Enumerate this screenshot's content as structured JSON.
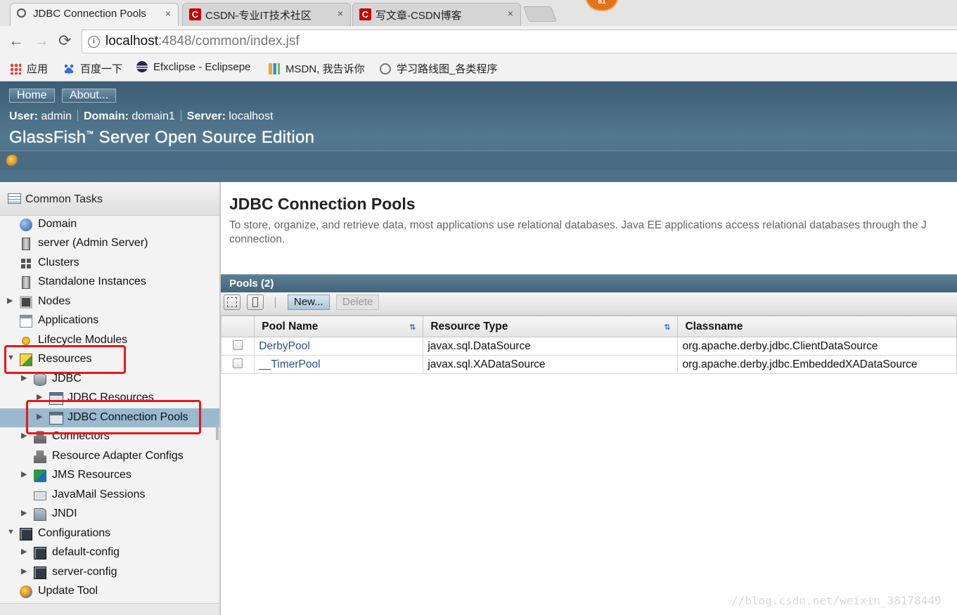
{
  "browser": {
    "tabs": [
      {
        "title": "JDBC Connection Pools",
        "close": "×",
        "active": true
      },
      {
        "title": "CSDN-专业IT技术社区",
        "close": "×",
        "active": false
      },
      {
        "title": "写文章-CSDN博客",
        "close": "×",
        "active": false
      }
    ],
    "badge": "81",
    "address": {
      "host": "localhost",
      "path": ":4848/common/index.jsf"
    },
    "nav": {
      "back": "←",
      "forward": "→",
      "reload": "⟳"
    },
    "bookmarks": [
      {
        "label": "应用",
        "icon": "apps-grid-icon"
      },
      {
        "label": "百度一下",
        "icon": "baidu-paw-icon"
      },
      {
        "label": "Efxclipse - Eclipsepe",
        "icon": "eclipse-icon"
      },
      {
        "label": "MSDN, 我告诉你",
        "icon": "msdn-icon"
      },
      {
        "label": "学习路线图_各类程序",
        "icon": "clock-icon"
      }
    ]
  },
  "header": {
    "home": "Home",
    "about": "About...",
    "user_label": "User:",
    "user": "admin",
    "domain_label": "Domain:",
    "domain": "domain1",
    "server_label": "Server:",
    "server": "localhost",
    "product": "GlassFish",
    "product_tm": "™",
    "product_rest": " Server Open Source Edition"
  },
  "tree": {
    "header": "Common Tasks",
    "items": {
      "domain": "Domain",
      "server": "server (Admin Server)",
      "clusters": "Clusters",
      "standalone": "Standalone Instances",
      "nodes": "Nodes",
      "applications": "Applications",
      "lifecycle": "Lifecycle Modules",
      "resources": "Resources",
      "jdbc": "JDBC",
      "jdbc_resources": "JDBC Resources",
      "jdbc_pools": "JDBC Connection Pools",
      "connectors": "Connectors",
      "resource_adapter": "Resource Adapter Configs",
      "jms": "JMS Resources",
      "javamail": "JavaMail Sessions",
      "jndi": "JNDI",
      "configurations": "Configurations",
      "default_config": "default-config",
      "server_config": "server-config",
      "update_tool": "Update Tool"
    }
  },
  "main": {
    "title": "JDBC Connection Pools",
    "description": "To store, organize, and retrieve data, most applications use relational databases. Java EE applications access relational databases through the JDBC API. Before an application can access a database, it must get a connection.",
    "description_visible_1": "To store, organize, and retrieve data, most applications use relational databases. Java EE applications access relational databases through the J",
    "description_visible_2": "connection.",
    "pools_header": "Pools (2)",
    "new_button": "New...",
    "delete_button": "Delete",
    "columns": {
      "name": "Pool Name",
      "type": "Resource Type",
      "classname": "Classname"
    },
    "rows": [
      {
        "name": "DerbyPool",
        "type": "javax.sql.DataSource",
        "classname": "org.apache.derby.jdbc.ClientDataSource"
      },
      {
        "name": "__TimerPool",
        "type": "javax.sql.XADataSource",
        "classname": "org.apache.derby.jdbc.EmbeddedXADataSource"
      }
    ]
  },
  "watermark": "//blog.csdn.net/weixin_38178449",
  "colors": {
    "highlight_box": "#e8171b",
    "header_blue": "#4c7189",
    "selected_row": "#99b9cf",
    "link": "#2b4f8f"
  }
}
